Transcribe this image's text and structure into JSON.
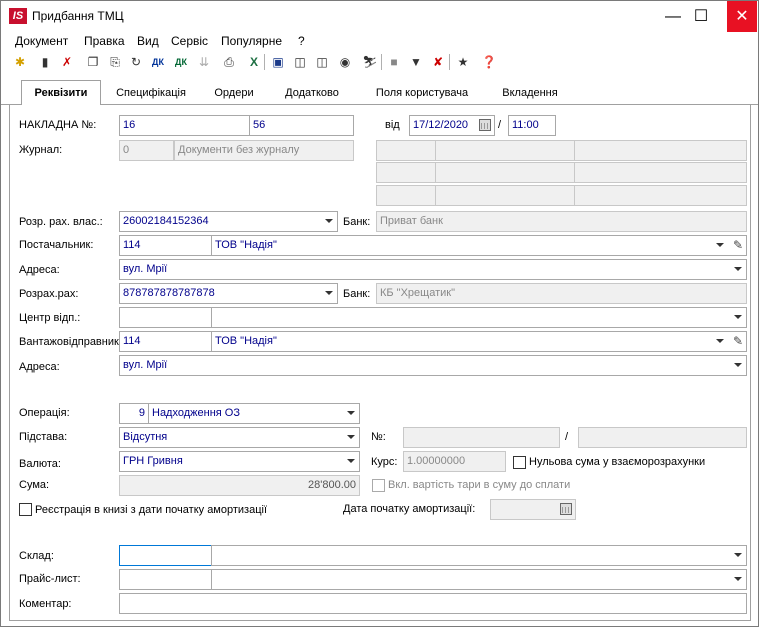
{
  "window": {
    "title": "Придбання ТМЦ",
    "logo": "IS",
    "controls": [
      "minimize",
      "maximize",
      "close"
    ]
  },
  "menu": [
    "Документ",
    "Правка",
    "Вид",
    "Сервіс",
    "Популярне",
    "?"
  ],
  "toolbar_icons": [
    "new-icon",
    "delete-icon",
    "cut-icon",
    "copy-icon",
    "paste-icon",
    "refresh-icon",
    "dk-debit-icon",
    "dk-credit-icon",
    "disabled-icon",
    "print-icon",
    "excel-icon",
    "save-icon",
    "book-icon",
    "book-open-icon",
    "users-icon",
    "tree-icon",
    "stop-icon",
    "filter-icon",
    "clear-filter-icon",
    "star-icon",
    "help-icon"
  ],
  "tabs": [
    "Реквізити",
    "Специфікація",
    "Ордери",
    "Додатково",
    "Поля користувача",
    "Вкладення"
  ],
  "active_tab": "Реквізити",
  "form": {
    "invoice": {
      "label": "НАКЛАДНА №:",
      "number": "16",
      "number2": "56",
      "date_label": "від",
      "date": "17/12/2020",
      "slash": "/",
      "time": "11:00"
    },
    "journal": {
      "label": "Журнал:",
      "code": "0",
      "name": "Документи без журналу"
    },
    "settlement_own": {
      "label": "Розр. рах. влас.:",
      "value": "26002184152364",
      "bank_label": "Банк:",
      "bank": "Приват банк"
    },
    "supplier": {
      "label": "Постачальник:",
      "code": "114",
      "name": "ТОВ \"Надія\""
    },
    "address1": {
      "label": "Адреса:",
      "value": "вул. Мрії"
    },
    "settlement": {
      "label": "Розрах.рах:",
      "value": "878787878787878",
      "bank_label": "Банк:",
      "bank": "КБ \"Хрещатик\""
    },
    "responsibility_center": {
      "label": "Центр відп.:",
      "code": "",
      "name": ""
    },
    "shipper": {
      "label": "Вантажовідправник",
      "code": "114",
      "name": "ТОВ \"Надія\""
    },
    "address2": {
      "label": "Адреса:",
      "value": "вул. Мрії"
    },
    "operation": {
      "label": "Операція:",
      "code": "9",
      "name": "Надходження ОЗ"
    },
    "basis": {
      "label": "Підстава:",
      "value": "Відсутня",
      "no_label": "№:",
      "slash": "/"
    },
    "currency": {
      "label": "Валюта:",
      "value": "ГРН Гривня",
      "rate_label": "Курс:",
      "rate": "1.00000000",
      "zero_sum_label": "Нульова сума у взаєморозрахунки"
    },
    "sum": {
      "label": "Сума:",
      "value": "28'800.00",
      "tare_label": "Вкл. вартість тари в суму до сплати"
    },
    "registration": {
      "label": "Реєстрація в книзі з дати початку амортизації",
      "date_label": "Дата початку амортизації:"
    },
    "warehouse": {
      "label": "Склад:"
    },
    "price_list": {
      "label": "Прайс-лист:"
    },
    "comment": {
      "label": "Коментар:"
    }
  }
}
